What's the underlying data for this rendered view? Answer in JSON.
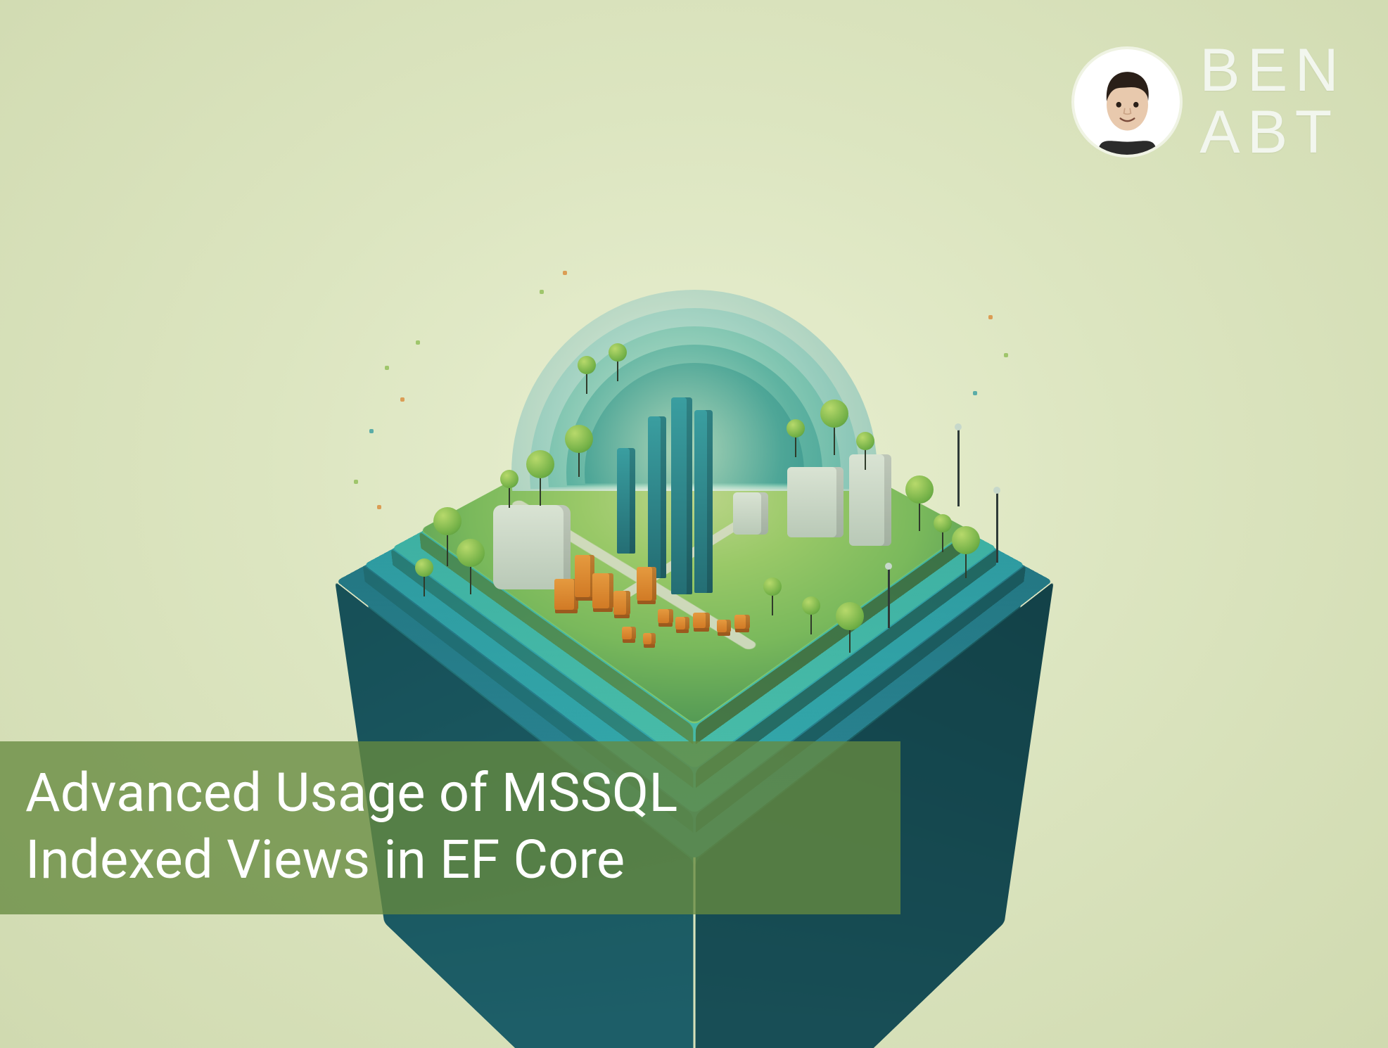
{
  "branding": {
    "name_line1": "BEN",
    "name_line2": "ABT"
  },
  "title": {
    "line1": "Advanced Usage of MSSQL",
    "line2": "Indexed Views in EF Core"
  },
  "palette": {
    "bg_light": "#e8efd0",
    "base_teal_dark": "#1e6a74",
    "base_teal": "#33a8ab",
    "grass": "#7ab95c",
    "orange": "#d98a38",
    "title_band": "rgba(103,138,64,0.78)",
    "title_text": "#ffffff",
    "name_text": "#f2f6ee"
  }
}
